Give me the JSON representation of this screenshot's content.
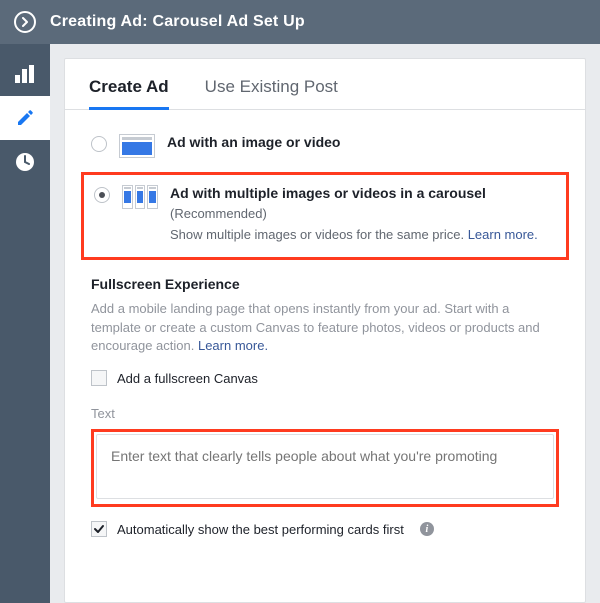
{
  "header": {
    "title": "Creating Ad: Carousel Ad Set Up"
  },
  "tabs": {
    "create": "Create Ad",
    "existing": "Use Existing Post"
  },
  "adOptions": {
    "single": {
      "title": "Ad with an image or video"
    },
    "carousel": {
      "title": "Ad with multiple images or videos in a carousel",
      "recommended": "(Recommended)",
      "desc": "Show multiple images or videos for the same price. ",
      "learn": "Learn more."
    }
  },
  "fullscreen": {
    "title": "Fullscreen Experience",
    "desc": "Add a mobile landing page that opens instantly from your ad. Start with a template or create a custom Canvas to feature photos, videos or products and encourage action. ",
    "learn": "Learn more.",
    "checkbox": "Add a fullscreen Canvas"
  },
  "text": {
    "label": "Text",
    "placeholder": "Enter text that clearly tells people about what you're promoting"
  },
  "autoShow": {
    "label": "Automatically show the best performing cards first"
  }
}
